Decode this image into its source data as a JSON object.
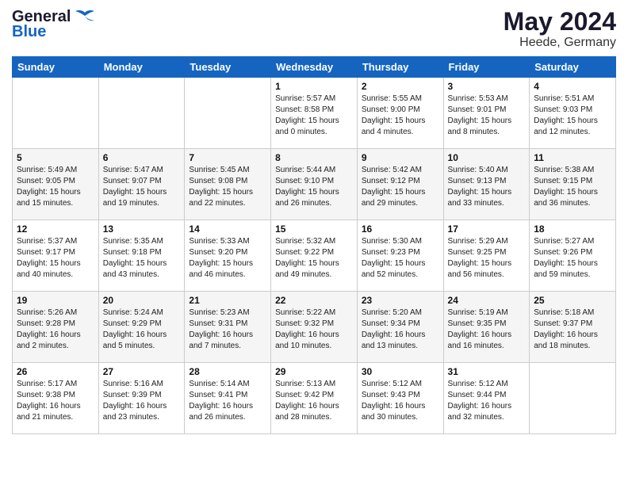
{
  "header": {
    "logo_line1": "General",
    "logo_line2": "Blue",
    "month": "May 2024",
    "location": "Heede, Germany"
  },
  "weekdays": [
    "Sunday",
    "Monday",
    "Tuesday",
    "Wednesday",
    "Thursday",
    "Friday",
    "Saturday"
  ],
  "weeks": [
    {
      "days": [
        {
          "num": "",
          "info": ""
        },
        {
          "num": "",
          "info": ""
        },
        {
          "num": "",
          "info": ""
        },
        {
          "num": "1",
          "info": "Sunrise: 5:57 AM\nSunset: 8:58 PM\nDaylight: 15 hours\nand 0 minutes."
        },
        {
          "num": "2",
          "info": "Sunrise: 5:55 AM\nSunset: 9:00 PM\nDaylight: 15 hours\nand 4 minutes."
        },
        {
          "num": "3",
          "info": "Sunrise: 5:53 AM\nSunset: 9:01 PM\nDaylight: 15 hours\nand 8 minutes."
        },
        {
          "num": "4",
          "info": "Sunrise: 5:51 AM\nSunset: 9:03 PM\nDaylight: 15 hours\nand 12 minutes."
        }
      ]
    },
    {
      "days": [
        {
          "num": "5",
          "info": "Sunrise: 5:49 AM\nSunset: 9:05 PM\nDaylight: 15 hours\nand 15 minutes."
        },
        {
          "num": "6",
          "info": "Sunrise: 5:47 AM\nSunset: 9:07 PM\nDaylight: 15 hours\nand 19 minutes."
        },
        {
          "num": "7",
          "info": "Sunrise: 5:45 AM\nSunset: 9:08 PM\nDaylight: 15 hours\nand 22 minutes."
        },
        {
          "num": "8",
          "info": "Sunrise: 5:44 AM\nSunset: 9:10 PM\nDaylight: 15 hours\nand 26 minutes."
        },
        {
          "num": "9",
          "info": "Sunrise: 5:42 AM\nSunset: 9:12 PM\nDaylight: 15 hours\nand 29 minutes."
        },
        {
          "num": "10",
          "info": "Sunrise: 5:40 AM\nSunset: 9:13 PM\nDaylight: 15 hours\nand 33 minutes."
        },
        {
          "num": "11",
          "info": "Sunrise: 5:38 AM\nSunset: 9:15 PM\nDaylight: 15 hours\nand 36 minutes."
        }
      ]
    },
    {
      "days": [
        {
          "num": "12",
          "info": "Sunrise: 5:37 AM\nSunset: 9:17 PM\nDaylight: 15 hours\nand 40 minutes."
        },
        {
          "num": "13",
          "info": "Sunrise: 5:35 AM\nSunset: 9:18 PM\nDaylight: 15 hours\nand 43 minutes."
        },
        {
          "num": "14",
          "info": "Sunrise: 5:33 AM\nSunset: 9:20 PM\nDaylight: 15 hours\nand 46 minutes."
        },
        {
          "num": "15",
          "info": "Sunrise: 5:32 AM\nSunset: 9:22 PM\nDaylight: 15 hours\nand 49 minutes."
        },
        {
          "num": "16",
          "info": "Sunrise: 5:30 AM\nSunset: 9:23 PM\nDaylight: 15 hours\nand 52 minutes."
        },
        {
          "num": "17",
          "info": "Sunrise: 5:29 AM\nSunset: 9:25 PM\nDaylight: 15 hours\nand 56 minutes."
        },
        {
          "num": "18",
          "info": "Sunrise: 5:27 AM\nSunset: 9:26 PM\nDaylight: 15 hours\nand 59 minutes."
        }
      ]
    },
    {
      "days": [
        {
          "num": "19",
          "info": "Sunrise: 5:26 AM\nSunset: 9:28 PM\nDaylight: 16 hours\nand 2 minutes."
        },
        {
          "num": "20",
          "info": "Sunrise: 5:24 AM\nSunset: 9:29 PM\nDaylight: 16 hours\nand 5 minutes."
        },
        {
          "num": "21",
          "info": "Sunrise: 5:23 AM\nSunset: 9:31 PM\nDaylight: 16 hours\nand 7 minutes."
        },
        {
          "num": "22",
          "info": "Sunrise: 5:22 AM\nSunset: 9:32 PM\nDaylight: 16 hours\nand 10 minutes."
        },
        {
          "num": "23",
          "info": "Sunrise: 5:20 AM\nSunset: 9:34 PM\nDaylight: 16 hours\nand 13 minutes."
        },
        {
          "num": "24",
          "info": "Sunrise: 5:19 AM\nSunset: 9:35 PM\nDaylight: 16 hours\nand 16 minutes."
        },
        {
          "num": "25",
          "info": "Sunrise: 5:18 AM\nSunset: 9:37 PM\nDaylight: 16 hours\nand 18 minutes."
        }
      ]
    },
    {
      "days": [
        {
          "num": "26",
          "info": "Sunrise: 5:17 AM\nSunset: 9:38 PM\nDaylight: 16 hours\nand 21 minutes."
        },
        {
          "num": "27",
          "info": "Sunrise: 5:16 AM\nSunset: 9:39 PM\nDaylight: 16 hours\nand 23 minutes."
        },
        {
          "num": "28",
          "info": "Sunrise: 5:14 AM\nSunset: 9:41 PM\nDaylight: 16 hours\nand 26 minutes."
        },
        {
          "num": "29",
          "info": "Sunrise: 5:13 AM\nSunset: 9:42 PM\nDaylight: 16 hours\nand 28 minutes."
        },
        {
          "num": "30",
          "info": "Sunrise: 5:12 AM\nSunset: 9:43 PM\nDaylight: 16 hours\nand 30 minutes."
        },
        {
          "num": "31",
          "info": "Sunrise: 5:12 AM\nSunset: 9:44 PM\nDaylight: 16 hours\nand 32 minutes."
        },
        {
          "num": "",
          "info": ""
        }
      ]
    }
  ]
}
